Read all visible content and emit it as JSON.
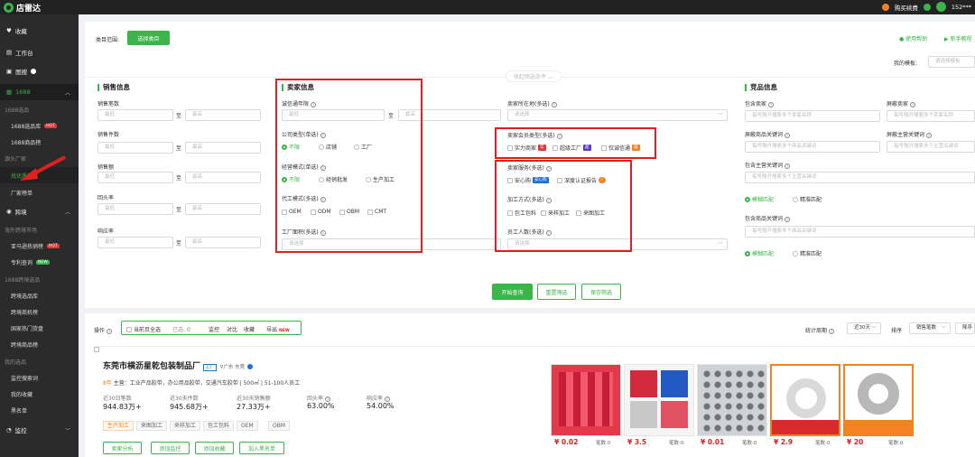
{
  "app": {
    "name": "店雷达",
    "buy_plan": "购买续费",
    "user": "152***"
  },
  "sidebar": {
    "favorites": "收藏",
    "workbench": "工作台",
    "image_search": "图搜",
    "section_1688": "1688",
    "group_1688": "1688选品",
    "item_1688_lib": "1688选品库",
    "hot": "HOT",
    "item_1688_goods": "1688商品榜",
    "group_source": "源头厂家",
    "item_find_factory": "找优质厂家",
    "item_factory_rank": "厂家榜单",
    "section_cross": "跨境",
    "group_overseas": "海外跨境市场",
    "item_amazon": "亚马逊热销榜",
    "item_patent": "专利查询",
    "new": "NEW",
    "group_1688_cross": "1688跨境选品",
    "item_cross_lib": "跨境选品库",
    "item_cross_biz": "跨境商机榜",
    "item_country_hot": "国家热门货盘",
    "item_cross_goods": "跨境商品榜",
    "group_mine": "我的选品",
    "item_monitor_search": "监控搜索词",
    "item_my_fav": "我的收藏",
    "item_blacklist": "黑名单",
    "section_monitor": "监控"
  },
  "filter": {
    "category_label": "类目范围:",
    "category_button": "选择类目",
    "help": "使用帮助",
    "novice": "新手教程",
    "template_label": "我的模板:",
    "template_placeholder": "请选择模板",
    "collapse": "收起筛选条件 ︿"
  },
  "sales": {
    "title": "销售信息",
    "to": "至",
    "min": "最低",
    "max": "最高",
    "f1": "销售笔数",
    "f2": "销售件数",
    "f3": "销售额",
    "f4": "回头率",
    "f5": "响应率"
  },
  "seller": {
    "title": "卖家信息",
    "years": "诚信通年限",
    "to": "至",
    "min": "最低",
    "max": "最高",
    "company_type": "公司类型(单选)",
    "ct_opts": [
      "不限",
      "店铺",
      "工厂"
    ],
    "biz_mode": "经营模式(单选)",
    "bm_opts": [
      "不限",
      "经销批发",
      "生产加工"
    ],
    "oem": "代工模式(多选)",
    "oem_opts": [
      "OEM",
      "ODM",
      "OBM",
      "CMT"
    ],
    "area": "工厂面积(多选)",
    "select": "请选择",
    "location": "卖家所在地(多选)",
    "member_type": "卖家会员类型(多选)",
    "mt_opts": [
      "实力商家",
      "超级工厂",
      "仅诚信通"
    ],
    "service": "卖家服务(多选)",
    "svc_opts": [
      "安心购",
      "深度认证报告"
    ],
    "svc_badge": "安心购",
    "process": "加工方式(多选)",
    "proc_opts": [
      "包工包料",
      "来样加工",
      "来图加工"
    ],
    "staff": "员工人数(多选)"
  },
  "competitor": {
    "title": "竞品信息",
    "include_seller": "包含卖家",
    "exclude_seller": "屏蔽卖家",
    "ph_seller": "每号隔开搜索多个卖家名称",
    "exclude_kw": "屏蔽商品关键词",
    "exclude_main_kw": "屏蔽主营关键词",
    "ph_kw": "每号隔开搜索多个商品关键词",
    "ph_main": "每号隔开搜索多个主营关键词",
    "include_main": "包含主营关键词",
    "include_goods": "包含商品关键词",
    "fuzzy": "模糊匹配",
    "exact": "精准匹配"
  },
  "actions": {
    "search": "开始查询",
    "reset": "重置筛选",
    "save": "保存筛选"
  },
  "toolbar": {
    "op": "操作",
    "select_page": "当前页全选",
    "selected": "已选:",
    "selected_count": "0",
    "monitor": "监控",
    "compare": "对比",
    "fav": "收藏",
    "export": "导出",
    "new": "NEW",
    "period_label": "统计周期",
    "period": "近30天",
    "sort_label": "排序",
    "sort": "销售笔数",
    "desc": "降序"
  },
  "result": {
    "name": "东莞市横沥星乾包装制品厂",
    "tag": "工厂",
    "location": "广东 东莞",
    "years": "8年",
    "main": "主营：工业产品胶带，办公用品胶带，交通汽车胶带",
    "area": "500㎡",
    "staff": "51-100人员工",
    "stats": [
      {
        "k": "近30日笔数",
        "v": "944.83万+"
      },
      {
        "k": "近30天件数",
        "v": "945.68万+"
      },
      {
        "k": "近30天销售额",
        "v": "27.33万+"
      },
      {
        "k": "回头率",
        "v": "63.00%"
      },
      {
        "k": "响应率",
        "v": "54.00%"
      }
    ],
    "tags": [
      "生产加工",
      "来图加工",
      "来样加工",
      "包工包料",
      "OEM",
      "OBM"
    ],
    "buttons": [
      "卖家分析",
      "添加监控",
      "添加收藏",
      "加入黑名单"
    ],
    "products": [
      {
        "price": "¥ 0.02",
        "sold": "笔数:0"
      },
      {
        "price": "¥ 3.5",
        "sold": "笔数:0"
      },
      {
        "price": "¥ 0.01",
        "sold": "笔数:0"
      },
      {
        "price": "¥ 2.9",
        "sold": "笔数:0"
      },
      {
        "price": "¥ 20",
        "sold": "笔数:0"
      }
    ]
  },
  "colors": {
    "accent": "#3bb44a",
    "highlight": "#e02020"
  }
}
